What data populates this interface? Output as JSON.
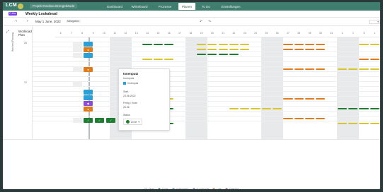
{
  "app": {
    "logo": "LCM",
    "project": "Projekt Neubau Bürogebäude"
  },
  "nav": [
    {
      "label": "Dashboard"
    },
    {
      "label": "Whiteboard"
    },
    {
      "label": "Prozesse"
    },
    {
      "label": "Planen"
    },
    {
      "label": "To Do"
    },
    {
      "label": "Einstellungen"
    }
  ],
  "page": {
    "badge": "Frühe",
    "title": "Weekly Lookahead"
  },
  "toolbar": {
    "date": "May 1 June, 2022",
    "today": "Navigation",
    "dropdown": "▾"
  },
  "workload": {
    "title": "Workload Plan",
    "vertical_label": "Wochen-Planung",
    "row1": "25",
    "row2": "12"
  },
  "days": [
    "6",
    "7",
    "8",
    "9",
    "10",
    "11",
    "12",
    "13",
    "14",
    "15",
    "16",
    "17",
    "18",
    "19",
    "20",
    "21",
    "22",
    "23",
    "24",
    "25",
    "26",
    "27",
    "28",
    "29",
    "30",
    "31",
    "1",
    "2",
    "3",
    "4",
    "5"
  ],
  "popup": {
    "title": "Innenputz",
    "sub": "Innenputz",
    "tag": "Innenputz",
    "date_label": "Start",
    "date": "23.06.2022",
    "duration_label": "Fertig / Ende",
    "duration": "26.06",
    "status_label": "Status",
    "status": "Done"
  },
  "legend": [
    {
      "label": "Open",
      "color": "#ffffff"
    },
    {
      "label": "Done",
      "color": "#1e7d2e"
    },
    {
      "label": "In Progress",
      "color": "#2aa0d6"
    },
    {
      "label": "In Approval",
      "color": "#8c4bd8"
    },
    {
      "label": "Late",
      "color": "#e07b1a"
    },
    {
      "label": "Overdue",
      "color": "#d93b2e"
    }
  ],
  "colors": {
    "accent": "#3f7d6e",
    "purple": "#7b3fe4"
  }
}
